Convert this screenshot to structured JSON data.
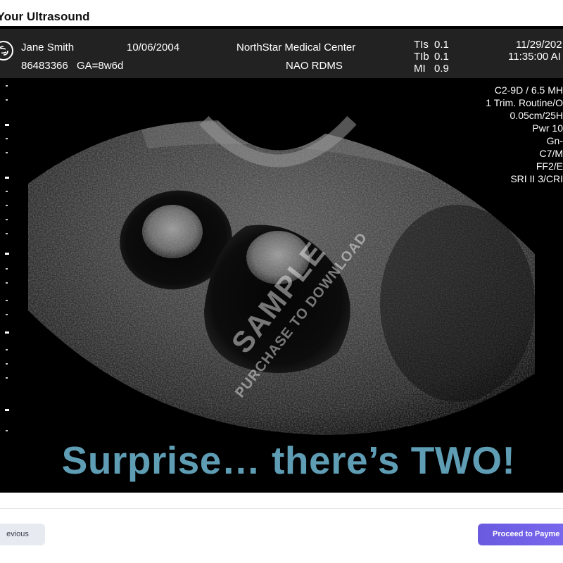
{
  "page": {
    "title": "w Your Ultrasound"
  },
  "ultrasound": {
    "header": {
      "patient_name": "Jane Smith",
      "patient_dob": "10/06/2004",
      "patient_id": "86483366",
      "gestational_age": "GA=8w6d",
      "facility": "NorthStar Medical Center",
      "department": "NAO RDMS",
      "tis_label": "TIs",
      "tis_value": "0.1",
      "tib_label": "TIb",
      "tib_value": "0.1",
      "mi_label": "MI",
      "mi_value": "0.9",
      "date": "11/29/202",
      "time": "11:35:00 AI"
    },
    "parameters": [
      "C2-9D / 6.5 MH",
      "1 Trim. Routine/O",
      "0.05cm/25H",
      "Pwr 10",
      "Gn-",
      "C7/M",
      "FF2/E",
      "SRI II 3/CRI"
    ],
    "watermark": {
      "line1": "SAMPLE",
      "line2": "PURCHASE TO DOWNLOAD"
    },
    "caption": "Surprise… there’s TWO!",
    "caption_color": "#5e9db4"
  },
  "footer": {
    "previous_label": "evious",
    "proceed_label": "Proceed to Payme",
    "accent_color": "#6a5ae0"
  }
}
